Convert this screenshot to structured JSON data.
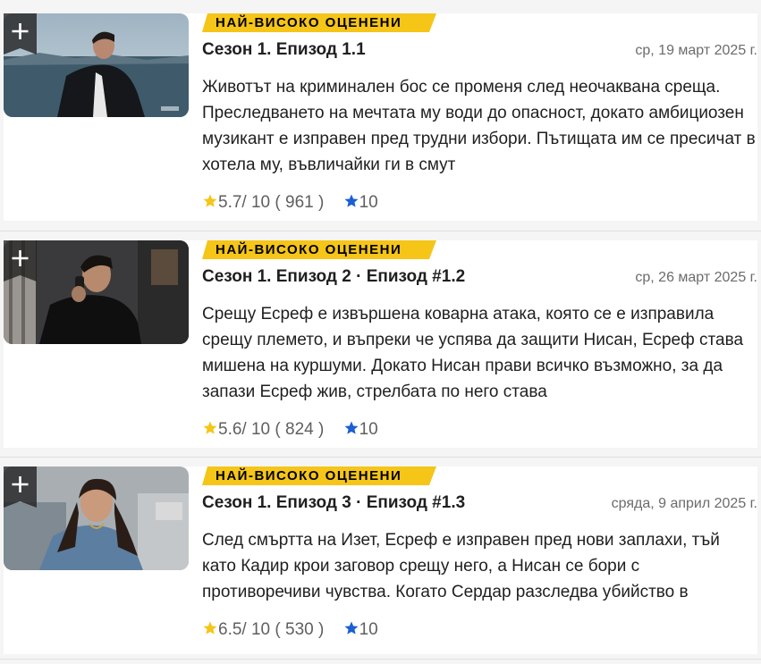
{
  "episodes": [
    {
      "badge": "НАЙ-ВИСОКО ОЦЕНЕНИ",
      "title": "Сезон 1. Епизод 1.1",
      "date": "ср, 19 март 2025 г.",
      "description": "Животът на криминален бос се променя след неочаквана среща. Преследването на мечтата му води до опасност, докато амбициозен музикант е изправен пред трудни избори. Пътищата им се пресичат в хотела му, въвличайки ги в смут",
      "rating": "5.7",
      "rating_max": "/ 10",
      "votes": "( 961 )",
      "user_rating": "10",
      "thumbnail_icon": "episode-still-man-by-water"
    },
    {
      "badge": "НАЙ-ВИСОКО ОЦЕНЕНИ",
      "title": "Сезон 1. Епизод 2 · Епизод #1.2",
      "date": "ср, 26 март 2025 г.",
      "description": "Срещу Есреф е извършена коварна атака, която се е изправила срещу племето, и въпреки че успява да защити Нисан, Есреф става мишена на куршуми. Докато Нисан прави всичко възможно, за да запази Есреф жив, стрелбата по него става",
      "rating": "5.6",
      "rating_max": "/ 10",
      "votes": "( 824 )",
      "user_rating": "10",
      "thumbnail_icon": "episode-still-man-on-phone"
    },
    {
      "badge": "НАЙ-ВИСОКО ОЦЕНЕНИ",
      "title": "Сезон 1. Епизод 3 · Епизод #1.3",
      "date": "сряда, 9 април 2025 г.",
      "description": "След смъртта на Изет, Есреф е изправен пред нови заплахи, тъй като Кадир крои заговор срещу него, а Нисан се бори с противоречиви чувства. Когато Сердар разследва убийство в",
      "rating": "6.5",
      "rating_max": "/ 10",
      "votes": "( 530 )",
      "user_rating": "10",
      "thumbnail_icon": "episode-still-woman-denim-jacket"
    }
  ],
  "colors": {
    "badge_yellow": "#f5c518",
    "star_yellow": "#f5c518",
    "star_blue": "#1a5fd3"
  }
}
